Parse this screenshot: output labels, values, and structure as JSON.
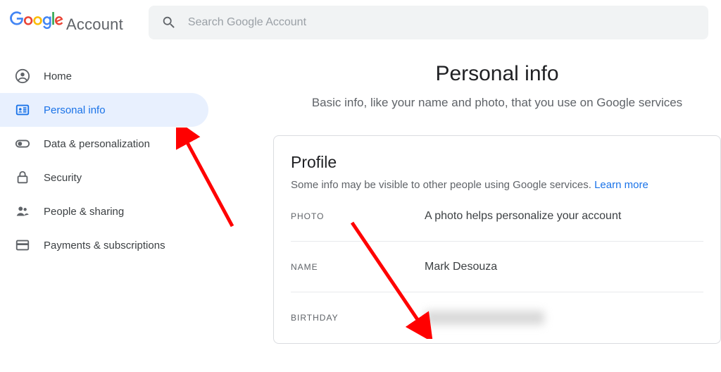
{
  "header": {
    "account_word": "Account",
    "search_placeholder": "Search Google Account"
  },
  "sidebar": {
    "items": [
      {
        "label": "Home"
      },
      {
        "label": "Personal info"
      },
      {
        "label": "Data & personalization"
      },
      {
        "label": "Security"
      },
      {
        "label": "People & sharing"
      },
      {
        "label": "Payments & subscriptions"
      }
    ]
  },
  "page": {
    "title": "Personal info",
    "subtitle": "Basic info, like your name and photo, that you use on Google services"
  },
  "profile": {
    "title": "Profile",
    "subtitle_pre": "Some info may be visible to other people using Google services. ",
    "learn_more": "Learn more",
    "rows": {
      "photo_label": "PHOTO",
      "photo_value": "A photo helps personalize your account",
      "name_label": "NAME",
      "name_value": "Mark Desouza",
      "birthday_label": "BIRTHDAY"
    }
  }
}
